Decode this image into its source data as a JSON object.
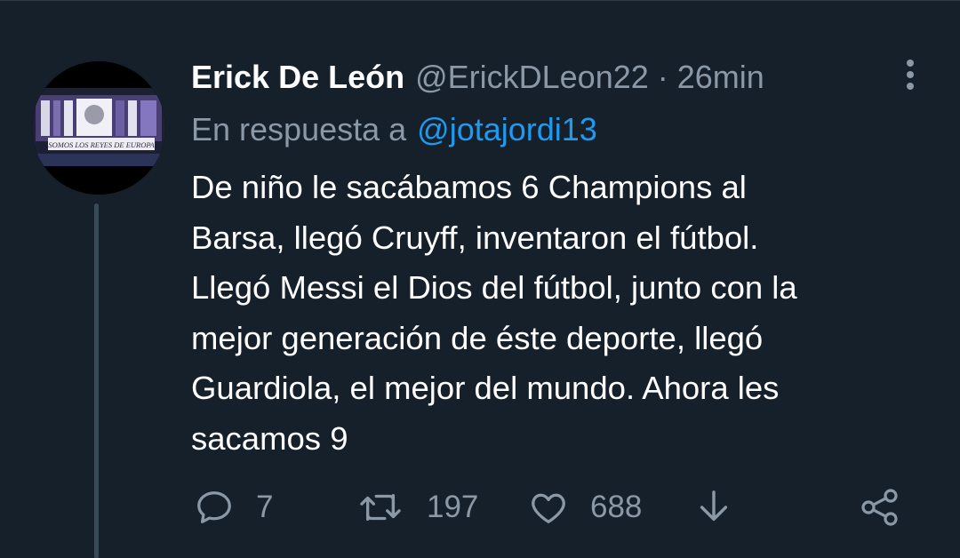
{
  "tweet": {
    "author_name": "Erick De León",
    "author_handle": "@ErickDLeon22",
    "separator": "·",
    "time": "26min",
    "reply_prefix": "En respuesta a",
    "reply_to_handle": "@jotajordi13",
    "text": "De niño le sacábamos 6 Champions al\nBarsa, llegó Cruyff, inventaron el fútbol.\nLlegó Messi el Dios del fútbol, junto con la\nmejor generación de éste deporte, llegó\nGuardiola, el mejor del mundo. Ahora les\nsacamos 9"
  },
  "actions": {
    "replies": "7",
    "retweets": "197",
    "likes": "688"
  },
  "icons": {
    "more": "more-vertical-icon",
    "reply": "comment-icon",
    "retweet": "retweet-icon",
    "like": "heart-icon",
    "download": "download-icon",
    "share": "share-icon"
  },
  "avatar_banner_text": "SOMOS LOS REYES DE EUROPA",
  "colors": {
    "background": "#15202b",
    "text": "#ffffff",
    "secondary": "#8b98a5",
    "accent": "#1d9bf0"
  }
}
